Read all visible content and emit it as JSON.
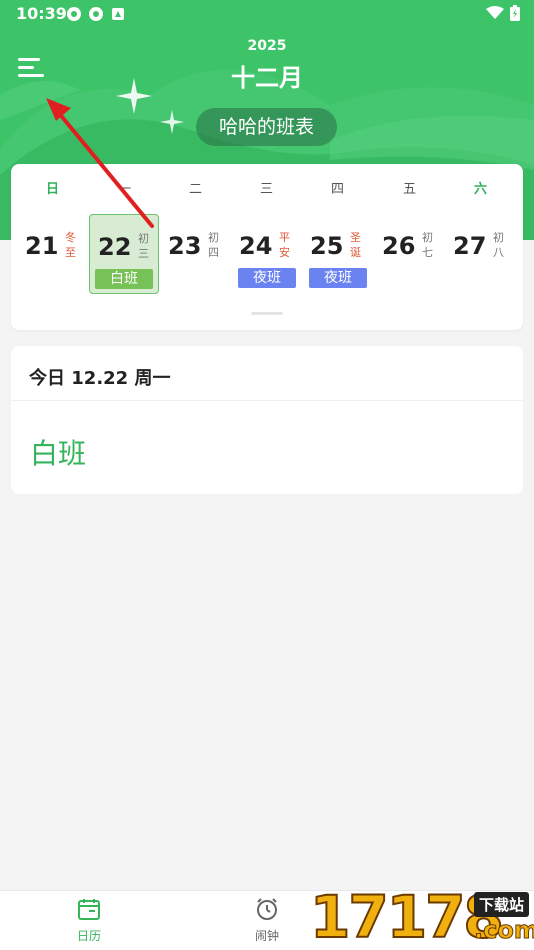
{
  "status": {
    "time": "10:39"
  },
  "header": {
    "year": "2025",
    "month": "十二月",
    "table_name": "哈哈的班表"
  },
  "weekdays": [
    "日",
    "一",
    "二",
    "三",
    "四",
    "五",
    "六"
  ],
  "days": [
    {
      "num": "21",
      "lunar": "冬至",
      "lunar_red": true,
      "shift": ""
    },
    {
      "num": "22",
      "lunar": "初三",
      "lunar_red": false,
      "shift": "白班",
      "selected": true
    },
    {
      "num": "23",
      "lunar": "初四",
      "lunar_red": false,
      "shift": ""
    },
    {
      "num": "24",
      "lunar": "平安",
      "lunar_red": true,
      "shift": "夜班"
    },
    {
      "num": "25",
      "lunar": "圣诞",
      "lunar_red": true,
      "shift": "夜班"
    },
    {
      "num": "26",
      "lunar": "初七",
      "lunar_red": false,
      "shift": ""
    },
    {
      "num": "27",
      "lunar": "初八",
      "lunar_red": false,
      "shift": ""
    }
  ],
  "today": {
    "title": "今日 12.22 周一",
    "shift": "白班"
  },
  "nav": {
    "calendar": "日历",
    "alarm": "闹钟"
  },
  "watermark": {
    "digits": "17178",
    "site": "下载站",
    "domain": ".com"
  },
  "colors": {
    "primary": "#3dc468",
    "day_shift": "#77c257",
    "night_shift": "#6a83f0",
    "annotation_arrow": "#e02020"
  }
}
